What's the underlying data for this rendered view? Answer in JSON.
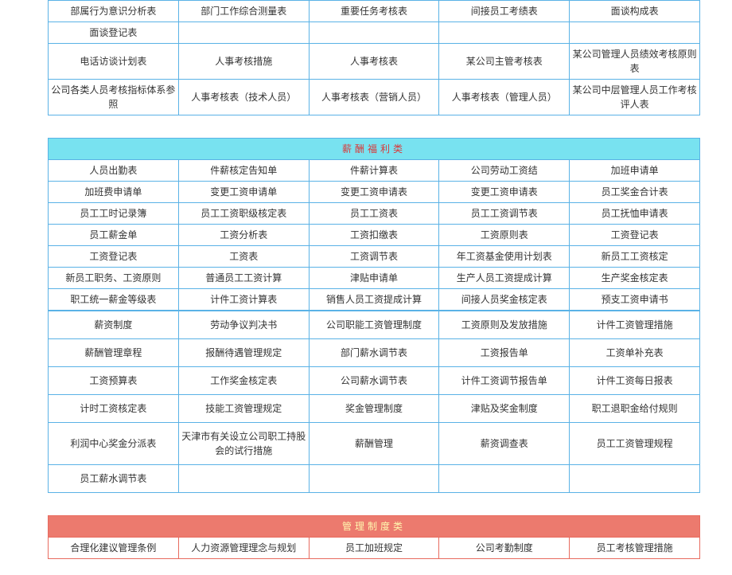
{
  "table1": {
    "rows": [
      [
        "部属行为意识分析表",
        "部门工作综合测量表",
        "重要任务考核表",
        "间接员工考绩表",
        "面谈构成表"
      ],
      [
        "面谈登记表",
        "",
        "",
        "",
        ""
      ],
      [
        "电话访谈计划表",
        "人事考核措施",
        "人事考核表",
        "某公司主管考核表",
        "某公司管理人员绩效考核原则表"
      ],
      [
        "公司各类人员考核指标体系参照",
        "人事考核表（技术人员）",
        "人事考核表（营销人员）",
        "人事考核表（管理人员）",
        "某公司中层管理人员工作考核评人表"
      ]
    ]
  },
  "table2": {
    "header": "薪酬福利类",
    "rows": [
      [
        "人员出勤表",
        "件薪核定告知单",
        "件薪计算表",
        "公司劳动工资结",
        "加班申请单"
      ],
      [
        "加班费申请单",
        "变更工资申请单",
        "变更工资申请表",
        "变更工资申请表",
        "员工奖金合计表"
      ],
      [
        "员工工时记录簿",
        "员工工资职级核定表",
        "员工工资表",
        "员工工资调节表",
        "员工抚恤申请表"
      ],
      [
        "员工薪金单",
        "工资分析表",
        "工资扣缴表",
        "工资原则表",
        "工资登记表"
      ],
      [
        "工资登记表",
        "工资表",
        "工资调节表",
        "年工资基金使用计划表",
        "新员工工资核定"
      ],
      [
        "新员工职务、工资原则",
        "普通员工工资计算",
        "津贴申请单",
        "生产人员工资提成计算",
        "生产奖金核定表"
      ],
      [
        "职工统一薪金等级表",
        "计件工资计算表",
        "销售人员工资提成计算",
        "间接人员奖金核定表",
        "预支工资申请书"
      ]
    ]
  },
  "table3": {
    "rows": [
      [
        "薪资制度",
        "劳动争议判决书",
        "公司职能工资管理制度",
        "工资原则及发放措施",
        "计件工资管理措施"
      ],
      [
        "薪酬管理章程",
        "报酬待遇管理规定",
        "部门薪水调节表",
        "工资报告单",
        "工资单补充表"
      ],
      [
        "工资预算表",
        "工作奖金核定表",
        "公司薪水调节表",
        "计件工资调节报告单",
        "计件工资每日报表"
      ],
      [
        "计时工资核定表",
        "技能工资管理规定",
        "奖金管理制度",
        "津贴及奖金制度",
        "职工退职金给付规则"
      ],
      [
        "利润中心奖金分派表",
        "天津市有关设立公司职工持股会的试行措施",
        "薪酬管理",
        "薪资调查表",
        "员工工资管理规程"
      ],
      [
        "员工薪水调节表",
        "",
        "",
        "",
        ""
      ]
    ]
  },
  "table4": {
    "header": "管理制度类",
    "rows": [
      [
        "合理化建议管理条例",
        "人力资源管理理念与规划",
        "员工加班规定",
        "公司考勤制度",
        "员工考核管理措施"
      ]
    ]
  }
}
